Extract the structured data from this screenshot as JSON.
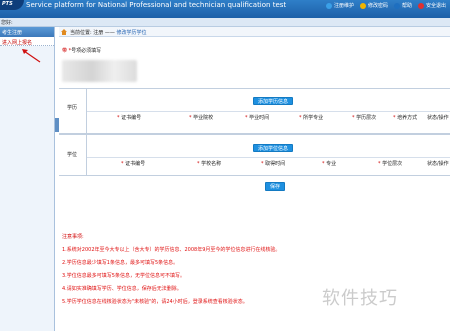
{
  "header": {
    "logo_text": "PTS",
    "subtitle": "Service platform for National Professional and technician qualification test",
    "links": [
      {
        "label": "注册维护",
        "color": "#3aa0e8"
      },
      {
        "label": "修改密码",
        "color": "#f0b400"
      },
      {
        "label": "帮助",
        "color": "#1e6fc0"
      },
      {
        "label": "安全退出",
        "color": "#e03030"
      }
    ]
  },
  "welcome": {
    "text": "您好:"
  },
  "sidebar": {
    "header": "考生注册",
    "items": [
      {
        "label": "进入网上报名"
      }
    ]
  },
  "breadcrumb": {
    "prefix": "当前位置: 注册 ——",
    "current": "修改学历学位"
  },
  "required_note": {
    "star": "带 *",
    "text": "号项必须填写"
  },
  "education": {
    "label": "学历",
    "add_button": "添加学历信息",
    "columns": [
      {
        "label": "证书编号",
        "required": true
      },
      {
        "label": "毕业院校",
        "required": true
      },
      {
        "label": "毕业时间",
        "required": true
      },
      {
        "label": "所学专业",
        "required": true
      },
      {
        "label": "学历层次",
        "required": true
      },
      {
        "label": "培养方式",
        "required": true
      },
      {
        "label": "状态/操作",
        "required": false
      }
    ]
  },
  "degree": {
    "label": "学位",
    "add_button": "添加学位信息",
    "columns": [
      {
        "label": "证书编号",
        "required": true
      },
      {
        "label": "学校名称",
        "required": true
      },
      {
        "label": "取得时间",
        "required": true
      },
      {
        "label": "专业",
        "required": true
      },
      {
        "label": "学位层次",
        "required": true
      },
      {
        "label": "状态/操作",
        "required": false
      }
    ]
  },
  "save_button": "保存",
  "notes": {
    "title": "注意事项:",
    "items": [
      "1.系统对2002年至今大专以上（含大专）的学历信息、2008年9月至今的学位信息进行在线核验。",
      "2.学历信息最少填写1条信息，最多可填写5条信息。",
      "3.学位信息最多可填写5条信息，无学位信息可不填写。",
      "4.请如实准确填写学历、学位信息，保存后无法删除。",
      "5.学历学位信息在线核验状态为\"未核验\"的，请24小时后，登录系统查看核验状态。"
    ]
  },
  "watermark": "软件技巧"
}
